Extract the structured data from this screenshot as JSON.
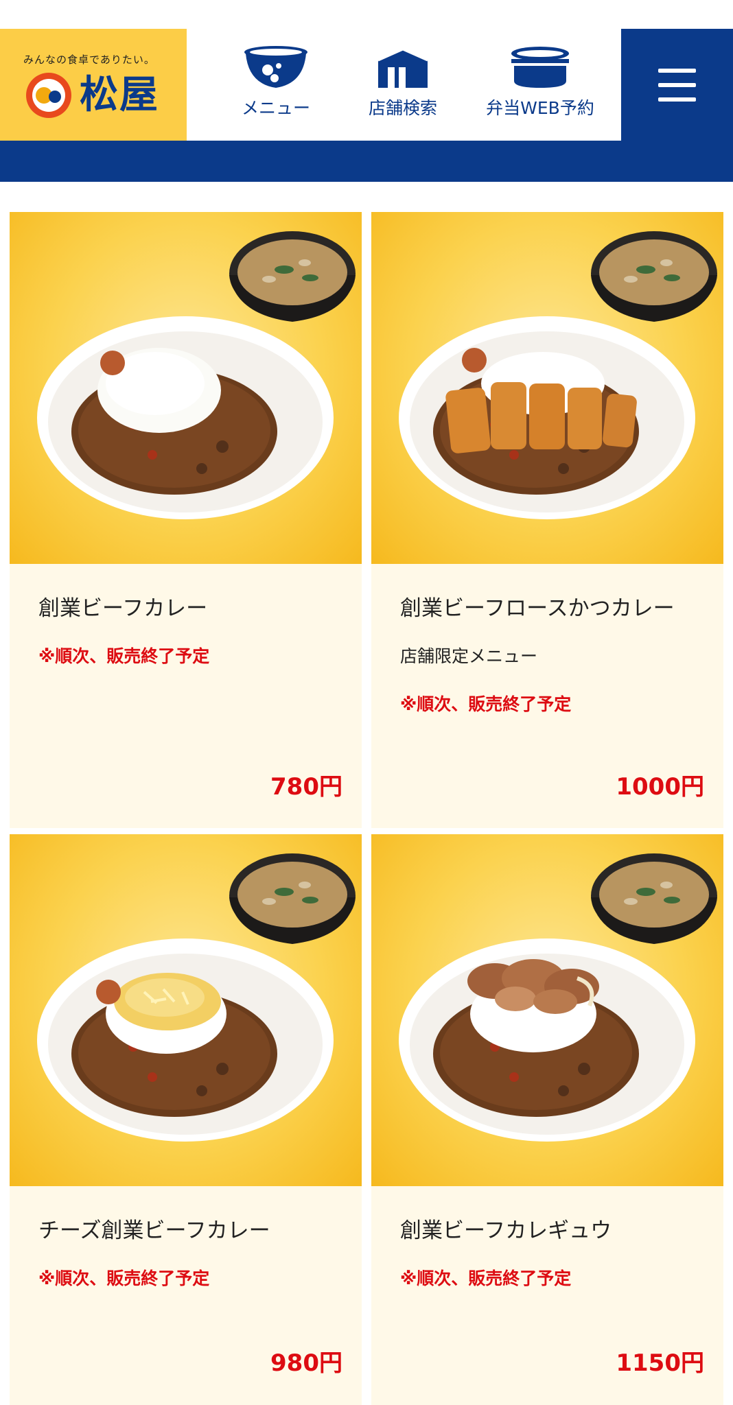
{
  "header": {
    "logo_tagline": "みんなの食卓でありたい。",
    "logo_name": "松屋",
    "nav": [
      {
        "label": "メニュー",
        "icon": "bowl-icon"
      },
      {
        "label": "店舗検索",
        "icon": "store-icon"
      },
      {
        "label": "弁当WEB予約",
        "icon": "bento-icon"
      }
    ],
    "menu_icon": "hamburger-icon"
  },
  "colors": {
    "brand_blue": "#0b3a8a",
    "brand_yellow": "#fccd47",
    "price_red": "#dd0c12",
    "card_bg": "#fff9e8"
  },
  "products": [
    {
      "name": "創業ビーフカレー",
      "note": "",
      "warning": "※順次、販売終了予定",
      "price": "780円",
      "topping": "plain"
    },
    {
      "name": "創業ビーフロースかつカレー",
      "note": "店舗限定メニュー",
      "warning": "※順次、販売終了予定",
      "price": "1000円",
      "topping": "katsu"
    },
    {
      "name": "チーズ創業ビーフカレー",
      "note": "",
      "warning": "※順次、販売終了予定",
      "price": "980円",
      "topping": "cheese"
    },
    {
      "name": "創業ビーフカレギュウ",
      "note": "",
      "warning": "※順次、販売終了予定",
      "price": "1150円",
      "topping": "gyu"
    }
  ]
}
